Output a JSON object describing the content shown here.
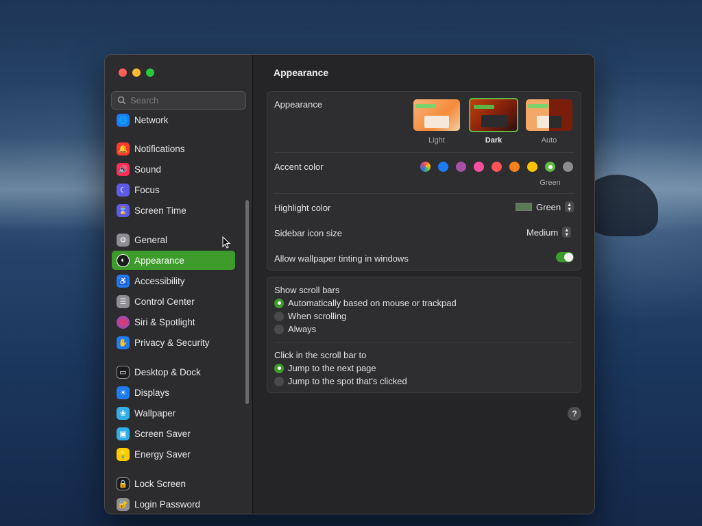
{
  "search": {
    "placeholder": "Search"
  },
  "sidebar": {
    "items": [
      {
        "label": "Network",
        "icon": "globe-icon",
        "color": "#1e7cf2"
      },
      {
        "label": "Notifications",
        "icon": "bell-icon",
        "color": "#ff3b30"
      },
      {
        "label": "Sound",
        "icon": "speaker-icon",
        "color": "#ff2d55"
      },
      {
        "label": "Focus",
        "icon": "moon-icon",
        "color": "#5e5ce6"
      },
      {
        "label": "Screen Time",
        "icon": "hourglass-icon",
        "color": "#5e5ce6"
      },
      {
        "label": "General",
        "icon": "gear-icon",
        "color": "#8e8e93"
      },
      {
        "label": "Appearance",
        "icon": "appearance-icon",
        "color": "#1c1c1e"
      },
      {
        "label": "Accessibility",
        "icon": "accessibility-icon",
        "color": "#1e7cf2"
      },
      {
        "label": "Control Center",
        "icon": "toggles-icon",
        "color": "#8e8e93"
      },
      {
        "label": "Siri & Spotlight",
        "icon": "siri-icon",
        "color": "#af52de"
      },
      {
        "label": "Privacy & Security",
        "icon": "hand-icon",
        "color": "#1e7cf2"
      },
      {
        "label": "Desktop & Dock",
        "icon": "dock-icon",
        "color": "#1c1c1e"
      },
      {
        "label": "Displays",
        "icon": "sun-icon",
        "color": "#1e7cf2"
      },
      {
        "label": "Wallpaper",
        "icon": "flower-icon",
        "color": "#32ade6"
      },
      {
        "label": "Screen Saver",
        "icon": "screensaver-icon",
        "color": "#32ade6"
      },
      {
        "label": "Energy Saver",
        "icon": "bulb-icon",
        "color": "#ffcc00"
      },
      {
        "label": "Lock Screen",
        "icon": "lock-icon",
        "color": "#1c1c1e"
      },
      {
        "label": "Login Password",
        "icon": "padlock-icon",
        "color": "#8e8e93"
      }
    ],
    "active_index": 6
  },
  "main": {
    "title": "Appearance",
    "appearance": {
      "label": "Appearance",
      "options": [
        "Light",
        "Dark",
        "Auto"
      ],
      "selected": "Dark"
    },
    "accent": {
      "label": "Accent color",
      "colors": [
        "#multicolor",
        "#1e7cf2",
        "#a550a7",
        "#f74f9e",
        "#ff5257",
        "#f7821b",
        "#ffc600",
        "#62ba46",
        "#8c8c8c"
      ],
      "selected_name": "Green"
    },
    "highlight": {
      "label": "Highlight color",
      "value": "Green",
      "swatch": "#5a7a55"
    },
    "icon_size": {
      "label": "Sidebar icon size",
      "value": "Medium"
    },
    "tinting": {
      "label": "Allow wallpaper tinting in windows",
      "enabled": true
    },
    "scroll_bars": {
      "label": "Show scroll bars",
      "options": [
        "Automatically based on mouse or trackpad",
        "When scrolling",
        "Always"
      ],
      "selected_index": 0
    },
    "click_scroll": {
      "label": "Click in the scroll bar to",
      "options": [
        "Jump to the next page",
        "Jump to the spot that's clicked"
      ],
      "selected_index": 0
    },
    "help": "?"
  },
  "colors": {
    "accent": "#3d9b2c"
  }
}
